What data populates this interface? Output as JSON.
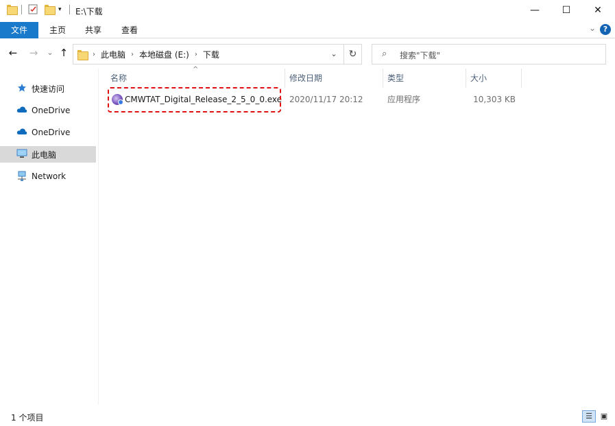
{
  "window": {
    "title": "E:\\下载",
    "min_glyph": "—",
    "max_glyph": "☐",
    "close_glyph": "✕"
  },
  "ribbon": {
    "tabs": [
      "文件",
      "主页",
      "共享",
      "查看"
    ],
    "help": "?",
    "collapse_glyph": "⌄"
  },
  "nav": {
    "back": "←",
    "forward": "→",
    "recent": "⌄",
    "up": "↑",
    "breadcrumb": [
      "此电脑",
      "本地磁盘 (E:)",
      "下载"
    ],
    "crumb_sep": "›",
    "dropdown": "⌄",
    "refresh": "↻",
    "search_placeholder": "搜索\"下载\"",
    "search_icon": "⌕"
  },
  "sidebar": {
    "items": [
      {
        "label": "快速访问",
        "icon": "star-icon"
      },
      {
        "label": "OneDrive",
        "icon": "cloud-icon"
      },
      {
        "label": "OneDrive",
        "icon": "cloud-icon"
      },
      {
        "label": "此电脑",
        "icon": "computer-icon",
        "selected": true
      },
      {
        "label": "Network",
        "icon": "network-icon"
      }
    ]
  },
  "columns": {
    "name": "名称",
    "modified": "修改日期",
    "type": "类型",
    "size": "大小",
    "sort_glyph": "^"
  },
  "files": [
    {
      "name": "CMWTAT_Digital_Release_2_5_0_0.exe",
      "modified": "2020/11/17 20:12",
      "type": "应用程序",
      "size": "10,303 KB",
      "icon": "app-exe-icon"
    }
  ],
  "status": {
    "count": "1 个项目",
    "details_view": "☰",
    "thumbnail_view": "▣"
  },
  "colors": {
    "file_tab_bg": "#1979ca",
    "highlight_border": "#e01010",
    "selected_nav_bg": "#d9d9d9"
  }
}
